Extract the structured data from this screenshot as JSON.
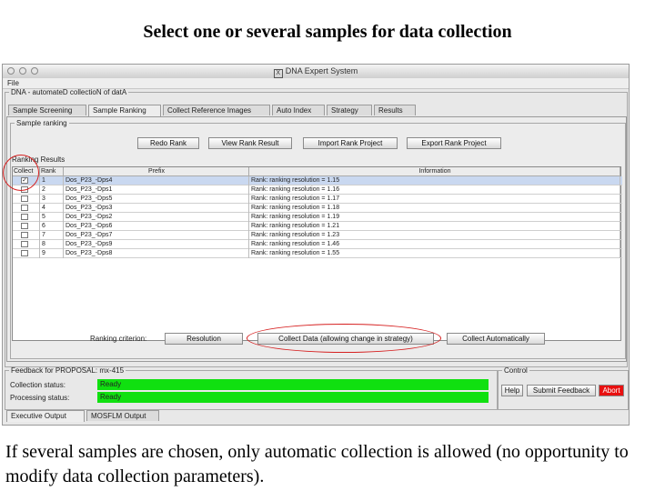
{
  "slide": {
    "title": "Select one or several samples for data collection",
    "caption": "If several samples are chosen, only automatic collection is allowed (no opportunity to modify data collection parameters)."
  },
  "window": {
    "title": "DNA Expert System",
    "menu": [
      "File"
    ]
  },
  "main_group": {
    "legend": "DNA - automateD collectioN of datA"
  },
  "tabs": [
    {
      "label": "Sample Screening",
      "active": false
    },
    {
      "label": "Sample Ranking",
      "active": true
    },
    {
      "label": "Collect Reference Images",
      "active": false
    },
    {
      "label": "Auto Index",
      "active": false
    },
    {
      "label": "Strategy",
      "active": false
    },
    {
      "label": "Results",
      "active": false
    }
  ],
  "ranking": {
    "group_legend": "Sample ranking",
    "buttons": [
      "Redo Rank",
      "View Rank Result",
      "Import Rank Project",
      "Export Rank Project"
    ],
    "results_label": "Ranking Results",
    "columns": [
      "Collect",
      "Rank",
      "Prefix",
      "Information"
    ],
    "rows": [
      {
        "checked": true,
        "rank": "1",
        "prefix": "Dos_P23_-Dps4",
        "info": "Rank: ranking resolution = 1.15"
      },
      {
        "checked": false,
        "rank": "2",
        "prefix": "Dos_P23_-Dps1",
        "info": "Rank: ranking resolution = 1.16"
      },
      {
        "checked": false,
        "rank": "3",
        "prefix": "Dos_P23_-Dps5",
        "info": "Rank: ranking resolution = 1.17"
      },
      {
        "checked": false,
        "rank": "4",
        "prefix": "Dos_P23_-Dps3",
        "info": "Rank: ranking resolution = 1.18"
      },
      {
        "checked": false,
        "rank": "5",
        "prefix": "Dos_P23_-Dps2",
        "info": "Rank: ranking resolution = 1.19"
      },
      {
        "checked": false,
        "rank": "6",
        "prefix": "Dos_P23_-Dps6",
        "info": "Rank: ranking resolution = 1.21"
      },
      {
        "checked": false,
        "rank": "7",
        "prefix": "Dos_P23_-Dps7",
        "info": "Rank: ranking resolution = 1.23"
      },
      {
        "checked": false,
        "rank": "8",
        "prefix": "Dos_P23_-Dps9",
        "info": "Rank: ranking resolution = 1.46"
      },
      {
        "checked": false,
        "rank": "9",
        "prefix": "Dos_P23_-Dps8",
        "info": "Rank: ranking resolution = 1.55"
      }
    ],
    "criterion_label": "Ranking criterion:",
    "criterion_value": "Resolution",
    "collect_data_button": "Collect Data (allowing change in strategy)",
    "collect_auto_button": "Collect Automatically"
  },
  "feedback": {
    "legend": "Feedback for PROPOSAL: mx-415",
    "collection_label": "Collection status:",
    "collection_value": "Ready",
    "processing_label": "Processing status:",
    "processing_value": "Ready",
    "status_color": "#10e010"
  },
  "control": {
    "legend": "Control",
    "help": "Help",
    "submit": "Submit Feedback",
    "abort": "Abort",
    "abort_color": "#e81010"
  },
  "bottom_tabs": [
    {
      "label": "Executive Output",
      "active": true
    },
    {
      "label": "MOSFLM Output",
      "active": false
    }
  ],
  "annotation_color": "#d62020"
}
